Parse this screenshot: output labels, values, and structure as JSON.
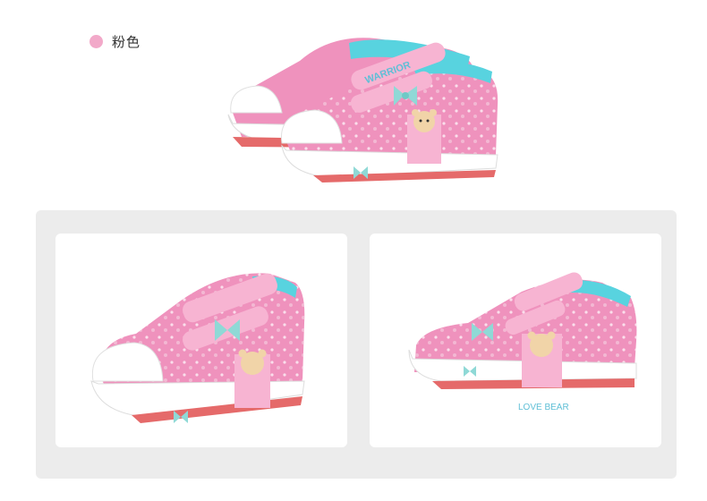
{
  "color_option": {
    "label": "粉色",
    "swatch_color": "#f2a9c9"
  },
  "product": {
    "shoe_text": "WARRIOR",
    "bear_text": "LOVE BEAR",
    "main_color": "#ef92bd",
    "lining_color": "#58d3df",
    "bow_color": "#8fd9d6",
    "sole_color": "#ffffff"
  },
  "images": [
    {
      "name": "hero-pair-image",
      "view": "pair"
    },
    {
      "name": "front-three-quarter-image",
      "view": "front"
    },
    {
      "name": "side-profile-image",
      "view": "side"
    }
  ]
}
